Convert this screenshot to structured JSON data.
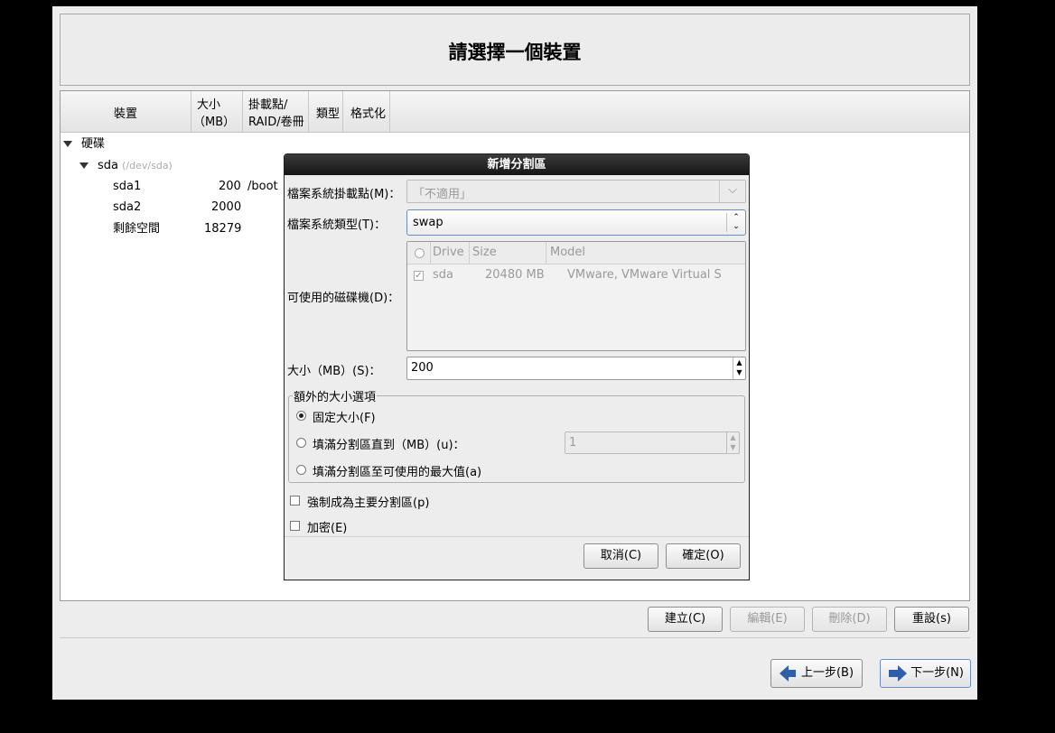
{
  "page_title": "請選擇一個裝置",
  "columns": {
    "device": "裝置",
    "size_line1": "大小",
    "size_line2": "（MB）",
    "mount_line1": "掛載點/",
    "mount_line2": "RAID/卷冊",
    "type": "類型",
    "format": "格式化"
  },
  "tree": {
    "group": "硬碟",
    "disk_name": "sda",
    "disk_path": "(/dev/sda)",
    "rows": [
      {
        "name": "sda1",
        "size": "200",
        "mount": "/boot"
      },
      {
        "name": "sda2",
        "size": "2000",
        "mount": ""
      },
      {
        "name": "剩餘空間",
        "size": "18279",
        "mount": ""
      }
    ]
  },
  "dialog": {
    "title": "新增分割區",
    "mount_label": "檔案系統掛載點(M)：",
    "mount_value": "「不適用」",
    "fstype_label": "檔案系統類型(T)：",
    "fstype_value": "swap",
    "drives_label": "可使用的磁碟機(D)：",
    "drives_headers": [
      "Drive",
      "Size",
      "Model"
    ],
    "drives": [
      {
        "drive": "sda",
        "size": "20480 MB",
        "model": "VMware, VMware Virtual S",
        "checked": true
      }
    ],
    "size_label": "大小（MB）(S)：",
    "size_value": "200",
    "options_title": "額外的大小選項",
    "opt_fixed": "固定大小(F)",
    "opt_fill_upto": "填滿分割區直到（MB）(u)：",
    "opt_fill_upto_value": "1",
    "opt_fill_max": "填滿分割區至可使用的最大值(a)",
    "force_primary": "強制成為主要分割區(p)",
    "encrypt": "加密(E)",
    "cancel": "取消(C)",
    "ok": "確定(O)"
  },
  "actions": {
    "create": "建立(C)",
    "edit": "編輯(E)",
    "delete": "刪除(D)",
    "reset": "重設(s)"
  },
  "nav": {
    "back": "上一步(B)",
    "next": "下一步(N)"
  },
  "colors": {
    "accent": "#2e5fa8",
    "dialog_title_bg": "#1e1e1e"
  }
}
